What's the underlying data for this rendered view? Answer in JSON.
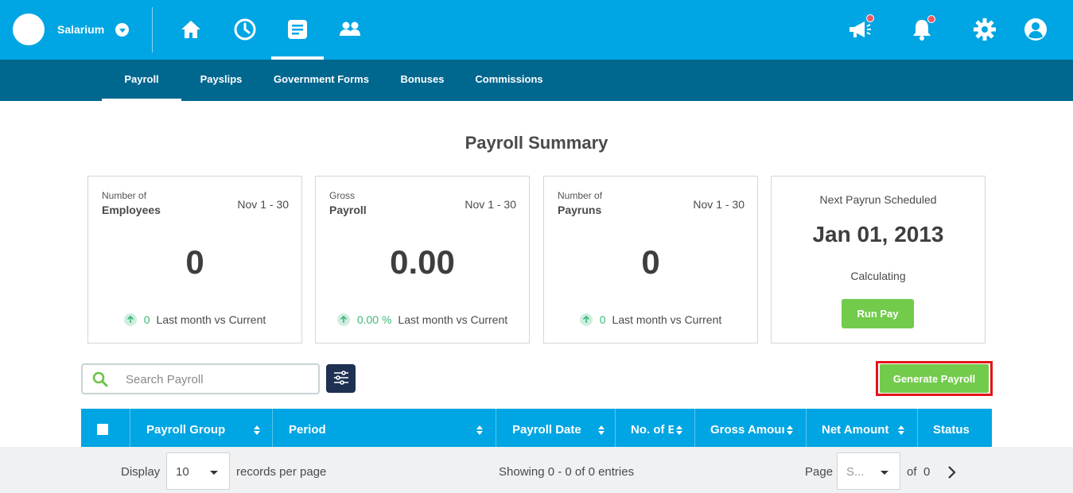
{
  "app": {
    "brand": "Salarium"
  },
  "nav": {
    "icons": [
      "home-icon",
      "clock-icon",
      "document-icon",
      "people-icon"
    ],
    "active": "document-icon"
  },
  "header_right": {
    "icons": [
      "megaphone-icon",
      "bell-icon",
      "gear-icon",
      "user-icon"
    ]
  },
  "subnav": {
    "items": [
      "Payroll",
      "Payslips",
      "Government Forms",
      "Bonuses",
      "Commissions"
    ],
    "active": "Payroll"
  },
  "page": {
    "title": "Payroll Summary"
  },
  "cards": [
    {
      "small": "Number of",
      "label": "Employees",
      "range": "Nov 1 - 30",
      "value": "0",
      "change": "0",
      "foot": "Last month vs Current"
    },
    {
      "small": "Gross",
      "label": "Payroll",
      "range": "Nov 1 - 30",
      "value": "0.00",
      "change": "0.00 %",
      "foot": "Last month vs Current"
    },
    {
      "small": "Number of",
      "label": "Payruns",
      "range": "Nov 1 - 30",
      "value": "0",
      "change": "0",
      "foot": "Last month vs Current"
    }
  ],
  "next_payrun": {
    "title": "Next Payrun Scheduled",
    "date": "Jan 01, 2013",
    "status": "Calculating",
    "button": "Run Pay"
  },
  "search": {
    "placeholder": "Search Payroll"
  },
  "actions": {
    "generate": "Generate Payroll"
  },
  "table": {
    "columns": [
      "Payroll Group",
      "Period",
      "Payroll Date",
      "No. of E",
      "Gross Amoun",
      "Net Amount",
      "Status"
    ]
  },
  "pagination": {
    "display_label": "Display",
    "per_page": "10",
    "per_page_label": "records per page",
    "showing": "Showing 0 - 0 of 0 entries",
    "page_label": "Page",
    "page_value": "S...",
    "of_label": "of",
    "total_pages": "0"
  },
  "colors": {
    "primary": "#00a5e3",
    "subnav": "#00678f",
    "green": "#72cb4b",
    "highlight": "#e3141a"
  }
}
